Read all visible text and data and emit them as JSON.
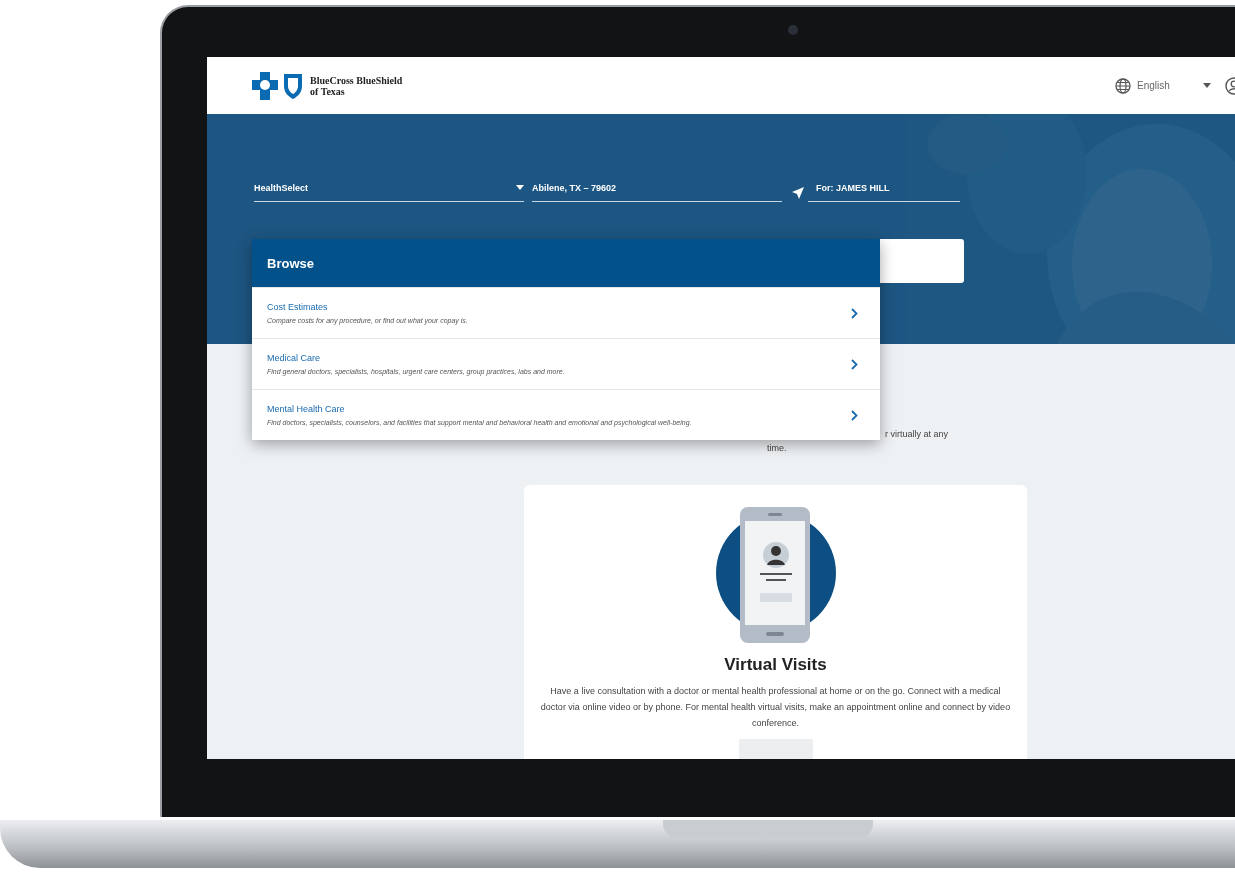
{
  "header": {
    "logo_lines": [
      "BlueCross BlueShield",
      "of Texas"
    ],
    "language": "English"
  },
  "filters": [
    {
      "kind": "select",
      "value": "HealthSelect"
    },
    {
      "kind": "location",
      "value": "Abilene, TX – 79602"
    },
    {
      "kind": "text",
      "value": "For: JAMES HILL"
    }
  ],
  "browse_menu": {
    "title": "Browse",
    "items": [
      {
        "title": "Cost Estimates",
        "description": "Compare costs for any procedure, or find out what your copay is."
      },
      {
        "title": "Medical Care",
        "description": "Find general doctors, specialists, hospitals, urgent care centers, group practices, labs and more."
      },
      {
        "title": "Mental Health Care",
        "description": "Find doctors, specialists, counselors, and facilities that support mental and behavioral health and emotional and psychological well-being."
      }
    ]
  },
  "intro_fragments": [
    "r virtually at any",
    "time."
  ],
  "card": {
    "title": "Virtual Visits",
    "description": "Have a live consultation with a doctor or mental health professional at home or on the go. Connect with a medical doctor via online video or by phone. For mental health virtual visits, make an appointment online and connect by video conference."
  }
}
